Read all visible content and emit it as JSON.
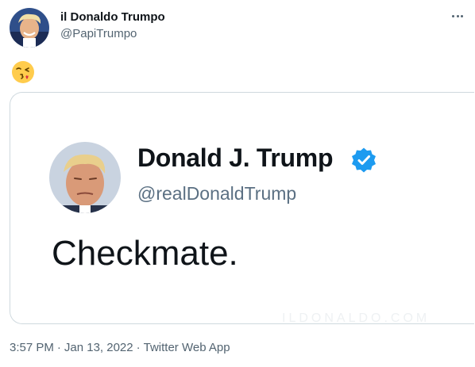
{
  "tweet": {
    "author": {
      "display_name": "il Donaldo Trumpo",
      "handle": "@PapiTrumpo"
    },
    "emoji": "kissing-face-with-heart-emoji",
    "media": {
      "quoted_name": "Donald J. Trump",
      "quoted_handle": "@realDonaldTrump",
      "quoted_text": "Checkmate.",
      "watermark": "ILDONALDO.COM"
    },
    "meta": {
      "time": "3:57 PM",
      "date": "Jan 13, 2022",
      "source": "Twitter Web App",
      "separator": "·"
    }
  },
  "colors": {
    "text_primary": "#0f1419",
    "text_secondary": "#536471",
    "card_border": "#cfd9de",
    "verified_blue": "#1d9bf0"
  }
}
